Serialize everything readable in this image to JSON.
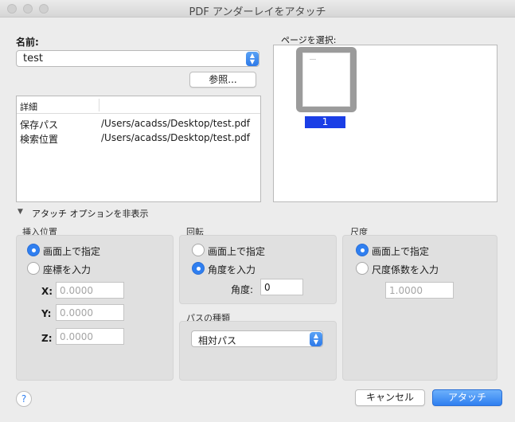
{
  "window": {
    "title": "PDF アンダーレイをアタッチ"
  },
  "name_section": {
    "label": "名前:",
    "value": "test",
    "browse_label": "参照..."
  },
  "details": {
    "header": "詳細",
    "rows": [
      {
        "key": "保存パス",
        "value": "/Users/acadss/Desktop/test.pdf"
      },
      {
        "key": "検索位置",
        "value": "/Users/acadss/Desktop/test.pdf"
      }
    ]
  },
  "page_select": {
    "label": "ページを選択:",
    "page_number": "1"
  },
  "options_toggle": "アタッチ オプションを非表示",
  "insertion": {
    "title": "挿入位置",
    "opt_screen": "画面上で指定",
    "opt_input": "座標を入力",
    "x_label": "X:",
    "x_value": "0.0000",
    "y_label": "Y:",
    "y_value": "0.0000",
    "z_label": "Z:",
    "z_value": "0.0000"
  },
  "rotation": {
    "title": "回転",
    "opt_screen": "画面上で指定",
    "opt_input": "角度を入力",
    "angle_label": "角度:",
    "angle_value": "0"
  },
  "path_type": {
    "title": "パスの種類",
    "value": "相対パス"
  },
  "scale": {
    "title": "尺度",
    "opt_screen": "画面上で指定",
    "opt_input": "尺度係数を入力",
    "value": "1.0000"
  },
  "footer": {
    "help": "?",
    "cancel_label": "キャンセル",
    "attach_label": "アタッチ"
  },
  "colors": {
    "accent": "#2f7ff0",
    "page_badge": "#1a3ee6"
  }
}
